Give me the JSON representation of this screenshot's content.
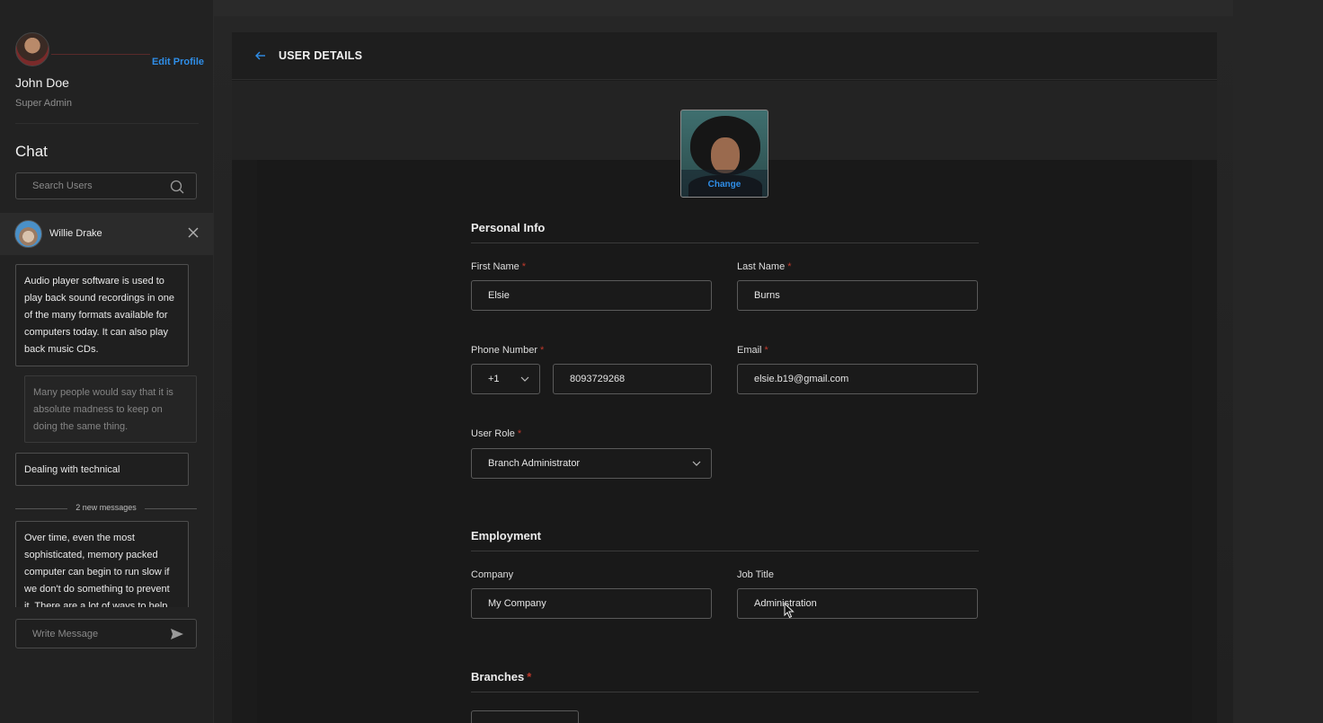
{
  "profile": {
    "name": "John Doe",
    "role": "Super Admin",
    "edit_label": "Edit Profile"
  },
  "chat": {
    "heading": "Chat",
    "search_placeholder": "Search Users",
    "active_user": "Willie Drake",
    "messages": [
      {
        "direction": "in",
        "text": "Audio player software is used to play back sound recordings in one of the many formats available for computers today. It can also play back music CDs."
      },
      {
        "direction": "out",
        "text": "Many people would say that it is absolute madness to keep on doing the same thing."
      },
      {
        "direction": "in",
        "text": "Dealing with technical"
      },
      {
        "direction": "in",
        "text": "Over time, even the most sophisticated, memory packed computer can begin to run slow if we don't do something to prevent it. There are a lot of ways to help"
      }
    ],
    "new_messages_label": "2 new messages",
    "write_placeholder": "Write Message"
  },
  "page": {
    "title": "USER DETAILS",
    "photo_change_label": "Change"
  },
  "personal_info": {
    "title": "Personal Info",
    "first_name_label": "First Name",
    "first_name": "Elsie",
    "last_name_label": "Last Name",
    "last_name": "Burns",
    "phone_label": "Phone Number",
    "country_code": "+1",
    "phone": "8093729268",
    "email_label": "Email",
    "email": "elsie.b19@gmail.com",
    "role_label": "User Role",
    "role": "Branch Administrator",
    "required_mark": "*"
  },
  "employment": {
    "title": "Employment",
    "company_label": "Company",
    "company": "My Company",
    "job_title_label": "Job Title",
    "job_title": "Administration"
  },
  "branches": {
    "title": "Branches"
  },
  "colors": {
    "accent": "#2f8ee8",
    "required": "#c0392b"
  }
}
